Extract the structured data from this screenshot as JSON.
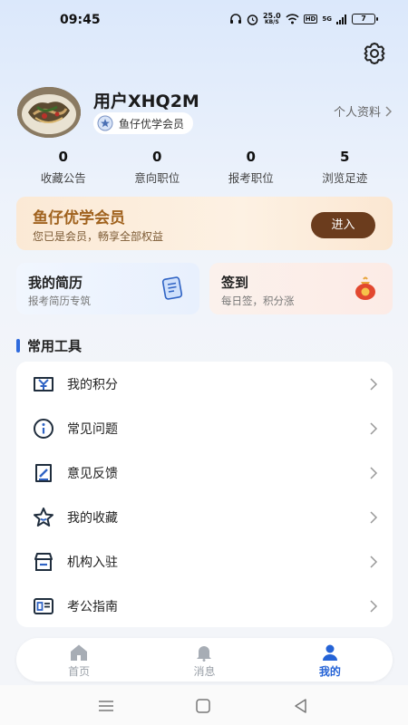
{
  "status_bar": {
    "time": "09:45",
    "net_speed_value": "25.0",
    "net_speed_unit": "KB/S",
    "hd_label": "HD",
    "signal_label": "5G",
    "battery_level": "7"
  },
  "profile": {
    "username": "用户XHQ2M",
    "member_label": "鱼仔优学会员",
    "profile_link": "个人资料"
  },
  "stats": [
    {
      "value": "0",
      "label": "收藏公告"
    },
    {
      "value": "0",
      "label": "意向职位"
    },
    {
      "value": "0",
      "label": "报考职位"
    },
    {
      "value": "5",
      "label": "浏览足迹"
    }
  ],
  "vip": {
    "title": "鱼仔优学会员",
    "subtitle": "您已是会员，畅享全部权益",
    "button": "进入"
  },
  "cards": {
    "resume": {
      "title": "我的简历",
      "subtitle": "报考简历专筑"
    },
    "sign": {
      "title": "签到",
      "subtitle": "每日签，积分涨"
    }
  },
  "tools": {
    "section_title": "常用工具",
    "items": [
      {
        "label": "我的积分",
        "icon": "points-icon"
      },
      {
        "label": "常见问题",
        "icon": "info-icon"
      },
      {
        "label": "意见反馈",
        "icon": "feedback-icon"
      },
      {
        "label": "我的收藏",
        "icon": "star-icon"
      },
      {
        "label": "机构入驻",
        "icon": "store-icon"
      },
      {
        "label": "考公指南",
        "icon": "guide-icon"
      }
    ]
  },
  "tabs": [
    {
      "label": "首页",
      "icon": "home-icon",
      "active": false
    },
    {
      "label": "消息",
      "icon": "bell-icon",
      "active": false
    },
    {
      "label": "我的",
      "icon": "user-icon",
      "active": true
    }
  ],
  "colors": {
    "accent": "#2563d6",
    "vip_text": "#a0621e",
    "vip_button": "#6b3c1d"
  }
}
